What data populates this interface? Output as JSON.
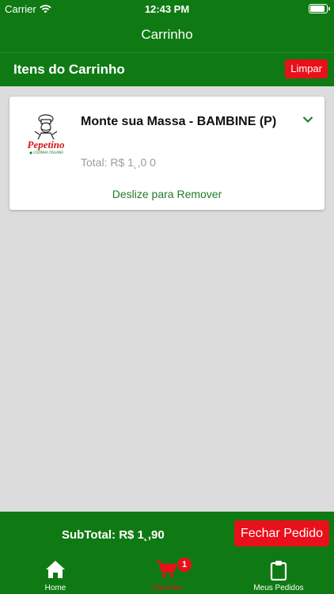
{
  "status_bar": {
    "carrier": "Carrier",
    "time": "12:43 PM"
  },
  "nav": {
    "title": "Carrinho"
  },
  "section": {
    "title": "Itens do Carrinho",
    "clear_label": "Limpar"
  },
  "cart_items": [
    {
      "name": "Monte sua Massa - BAMBINE (P)",
      "total": "Total: R$ 1˛,0 0",
      "remove_hint": "Deslize para Remover",
      "logo_text": "Pepetino",
      "logo_subtext": "COZINHA ITALIANA"
    }
  ],
  "footer": {
    "subtotal": "SubTotal: R$ 1˛,90",
    "checkout_label": "Fechar Pedido"
  },
  "tabs": [
    {
      "label": "Home",
      "icon": "home-icon"
    },
    {
      "label": "Carrinho",
      "icon": "cart-icon",
      "badge": "1",
      "active": true
    },
    {
      "label": "Meus Pedidos",
      "icon": "clipboard-icon"
    }
  ],
  "colors": {
    "primary": "#0f7a13",
    "accent": "#e8101a",
    "background": "#dcdcdc"
  }
}
